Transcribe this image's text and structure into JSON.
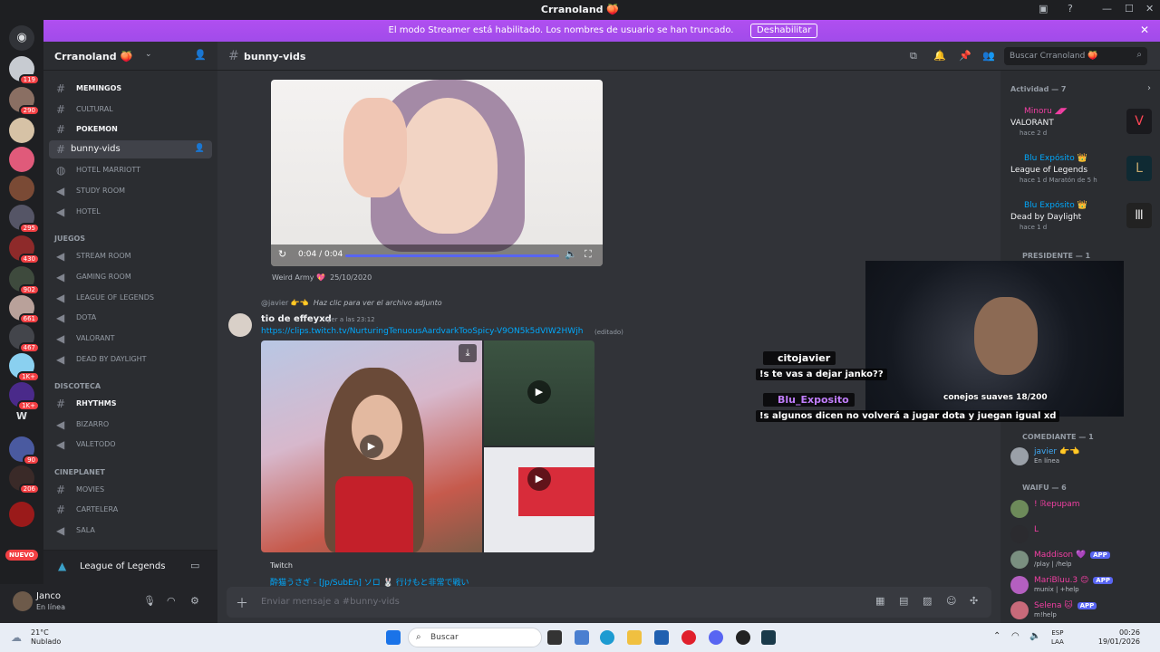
{
  "window": {
    "title": "Crranoland 🍑"
  },
  "banner": {
    "text": "El modo Streamer está habilitado. Los nombres de usuario se han truncado.",
    "button": "Deshabilitar"
  },
  "guild_badges": [
    "119",
    "290",
    "295",
    "430",
    "902",
    "661",
    "467",
    "1K+",
    "1K+",
    "90",
    "206"
  ],
  "guild_letter": "W",
  "nuevo": "NUEVO",
  "server": {
    "name": "Crranoland 🍑"
  },
  "channels": {
    "memingos": "MEMINGOS",
    "cultural": "CULTURAL",
    "pokemon": "POKEMON",
    "bunny": "bunny-vids",
    "hotel_marriott": "HOTEL MARRIOTT",
    "study_room": "STUDY ROOM",
    "hotel": "HOTEL",
    "juegos_cat": "JUEGOS",
    "stream_room": "STREAM ROOM",
    "gaming_room": "GAMING ROOM",
    "lol": "LEAGUE OF LEGENDS",
    "dota": "DOTA",
    "valorant": "VALORANT",
    "dbd": "DEAD BY DAYLIGHT",
    "discoteca_cat": "DISCOTECA",
    "rhythms": "RHYTHMS",
    "bizarro": "BIZARRO",
    "valetodo": "VALETODO",
    "cineplanet_cat": "CINEPLANET",
    "movies": "MOVIES",
    "cartelera": "CARTELERA",
    "sala": "SALA"
  },
  "voice_panel": {
    "text": "League of Legends"
  },
  "user": {
    "name": "Janco",
    "status": "En línea"
  },
  "header": {
    "channel": "bunny-vids",
    "search_placeholder": "Buscar Crranoland 🍑"
  },
  "video1": {
    "time": "0:04 / 0:04",
    "author": "Weird Army 💖",
    "date": "25/10/2020"
  },
  "message": {
    "reply_user": "@javier 👉👈",
    "reply_text": "Haz clic para ver el archivo adjunto",
    "author": "tio de effeyxd",
    "time": "ayer a las 23:12",
    "link": "https://clips.twitch.tv/NurturingTenuousAardvarkTooSpicy-V9ON5k5dVIW2HWjh",
    "edited": "(editado)",
    "provider": "Twitch",
    "embed_title": "酔猫うさぎ - [Jp/SubEn] ソロ 🐰 行けもと非常で戦い"
  },
  "composer": {
    "placeholder": "Enviar mensaje a #bunny-vids"
  },
  "stream_chat": {
    "line1_user": "citojavier",
    "line1_text": "!s te vas a dejar janko??",
    "line2_user": "Blu_Exposito",
    "line2_text": "!s algunos dicen no volverá a jugar dota y juegan igual xd",
    "line1_color": "#ffffff",
    "line2_color": "#c07dfb"
  },
  "webcam": {
    "caption": "conejos suaves 18/200"
  },
  "members": {
    "activity_header": "Actividad — 7",
    "activities": [
      {
        "user": "Minoru ◢◤",
        "game": "VALORANT",
        "ago": "hace 2 d"
      },
      {
        "user": "Blu Expósito 👑",
        "game": "League of Legends",
        "ago": "hace 1 d  Maratón de 5 h"
      },
      {
        "user": "Blu Expósito 👑",
        "game": "Dead by Daylight",
        "ago": "hace 1 d"
      }
    ],
    "presidente_header": "PRESIDENTE — 1",
    "comediante_header": "COMEDIANTE — 1",
    "comediante": {
      "name": "javier 👉👈",
      "sub": "En línea"
    },
    "waifu_header": "WAIFU — 6",
    "waifu": [
      {
        "name": "! ℝepupam",
        "sub": "",
        "color": "#f23fa3"
      },
      {
        "name": "L",
        "sub": "",
        "color": "#f23fa3"
      },
      {
        "name": "Maddison 💜",
        "sub": "/play | /help",
        "color": "#f23fa3",
        "app": "APP"
      },
      {
        "name": "MariBluu.3 😊",
        "sub": "munix | +help",
        "color": "#f23fa3",
        "app": "APP"
      },
      {
        "name": "Selena 🐱",
        "sub": "m!help",
        "color": "#f23fa3",
        "app": "APP"
      }
    ]
  },
  "taskbar": {
    "weather_temp": "21°C",
    "weather_desc": "Nublado",
    "search": "Buscar",
    "lang1": "ESP",
    "lang2": "LAA",
    "time": "00:26",
    "date": "19/01/2026"
  },
  "colors": {
    "accent": "#5865f2",
    "banner": "#a14bea",
    "link": "#00a8fc"
  }
}
